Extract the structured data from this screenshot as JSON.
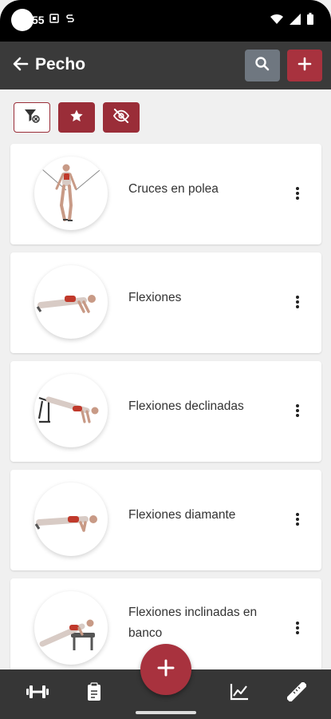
{
  "status_bar": {
    "time": "55",
    "icons": [
      "image-notification-icon",
      "s-notification-icon",
      "wifi-icon",
      "signal-icon",
      "battery-icon"
    ]
  },
  "app_bar": {
    "title": "Pecho",
    "icons": {
      "back": "arrow-left-icon",
      "search": "search-icon",
      "add": "plus-icon"
    }
  },
  "filters": [
    {
      "icon": "filter-off-icon",
      "style": "outline"
    },
    {
      "icon": "star-icon",
      "style": "filled"
    },
    {
      "icon": "eye-off-icon",
      "style": "filled"
    }
  ],
  "exercises": [
    {
      "name": "Cruces en polea",
      "figure": "cable-crossover"
    },
    {
      "name": "Flexiones",
      "figure": "push-up"
    },
    {
      "name": "Flexiones declinadas",
      "figure": "decline-push-up"
    },
    {
      "name": "Flexiones diamante",
      "figure": "diamond-push-up"
    },
    {
      "name": "Flexiones inclinadas en banco",
      "figure": "incline-bench-push-up"
    }
  ],
  "bottom_nav": [
    {
      "icon": "dumbbell-icon"
    },
    {
      "icon": "clipboard-icon"
    },
    {
      "icon": "plus-icon"
    },
    {
      "icon": "chart-line-icon"
    },
    {
      "icon": "ruler-icon"
    }
  ],
  "colors": {
    "accent": "#a8323e",
    "accent_dark": "#9a2d38",
    "app_bar": "#3a3a3a",
    "bottom_nav": "#363636",
    "search_button": "#6f7780",
    "background": "#f0f0f0"
  }
}
